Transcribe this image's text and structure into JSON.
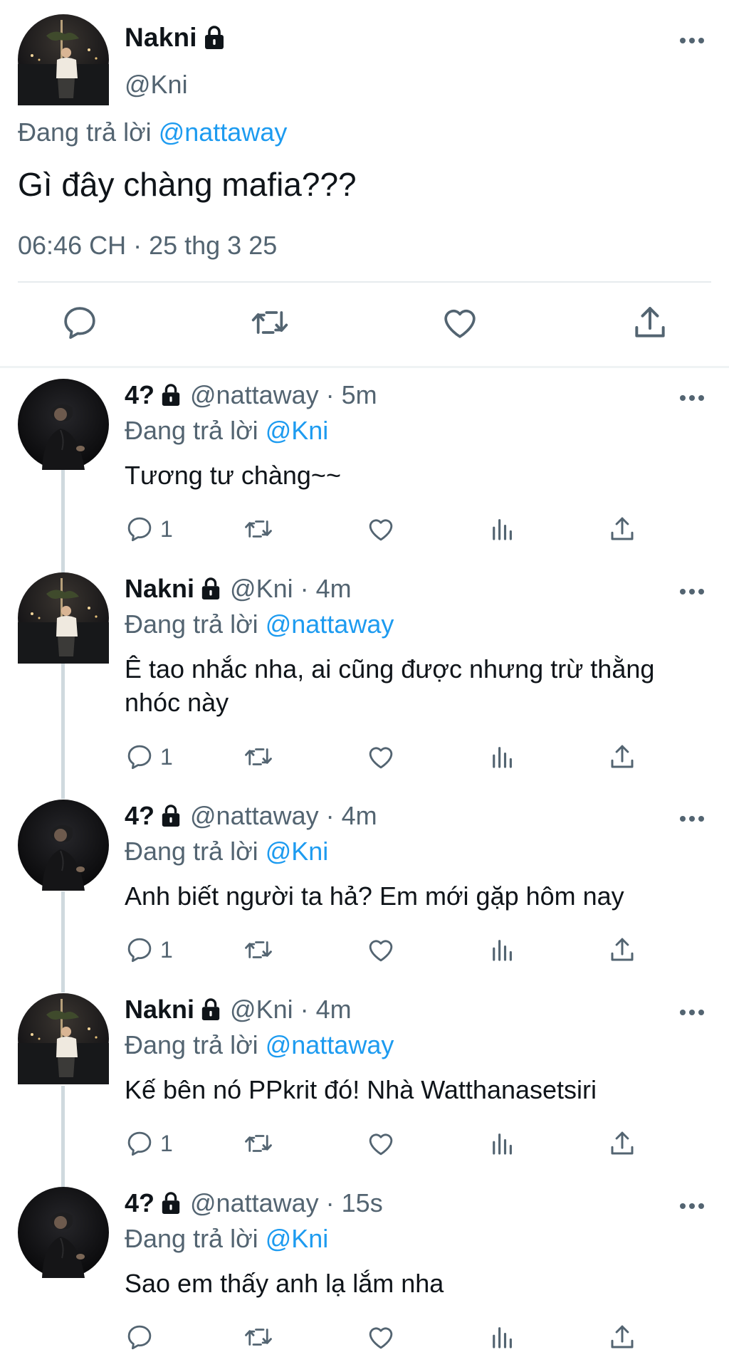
{
  "main": {
    "name": "Nakni",
    "handle": "@Kni",
    "replying_prefix": "Đang trả lời",
    "replying_to": "@nattaway",
    "text": "Gì đây chàng mafia???",
    "timestamp": "06:46 CH · 25 thg 3 25",
    "actions": [
      "reply-icon",
      "retweet-icon",
      "like-icon",
      "share-icon"
    ]
  },
  "replies": [
    {
      "name": "4?",
      "handle": "@nattaway",
      "age": "5m",
      "replying_prefix": "Đang trả lời",
      "replying_to": "@Kni",
      "text": "Tương tư chàng~~",
      "reply_count": "1"
    },
    {
      "name": "Nakni",
      "handle": "@Kni",
      "age": "4m",
      "replying_prefix": "Đang trả lời",
      "replying_to": "@nattaway",
      "text": "Ê tao nhắc nha, ai cũng được nhưng trừ thằng nhóc này",
      "reply_count": "1"
    },
    {
      "name": "4?",
      "handle": "@nattaway",
      "age": "4m",
      "replying_prefix": "Đang trả lời",
      "replying_to": "@Kni",
      "text": "Anh biết người ta hả? Em mới gặp hôm nay",
      "reply_count": "1"
    },
    {
      "name": "Nakni",
      "handle": "@Kni",
      "age": "4m",
      "replying_prefix": "Đang trả lời",
      "replying_to": "@nattaway",
      "text": "Kế bên nó PPkrit đó! Nhà Watthanasetsiri",
      "reply_count": "1"
    },
    {
      "name": "4?",
      "handle": "@nattaway",
      "age": "15s",
      "replying_prefix": "Đang trả lời",
      "replying_to": "@Kni",
      "text": "Sao em thấy anh lạ lắm nha",
      "reply_count": ""
    }
  ],
  "colors": {
    "accent": "#1d9bf0",
    "secondary_text": "#536471",
    "primary_text": "#0f1419",
    "divider": "#eff3f4"
  }
}
